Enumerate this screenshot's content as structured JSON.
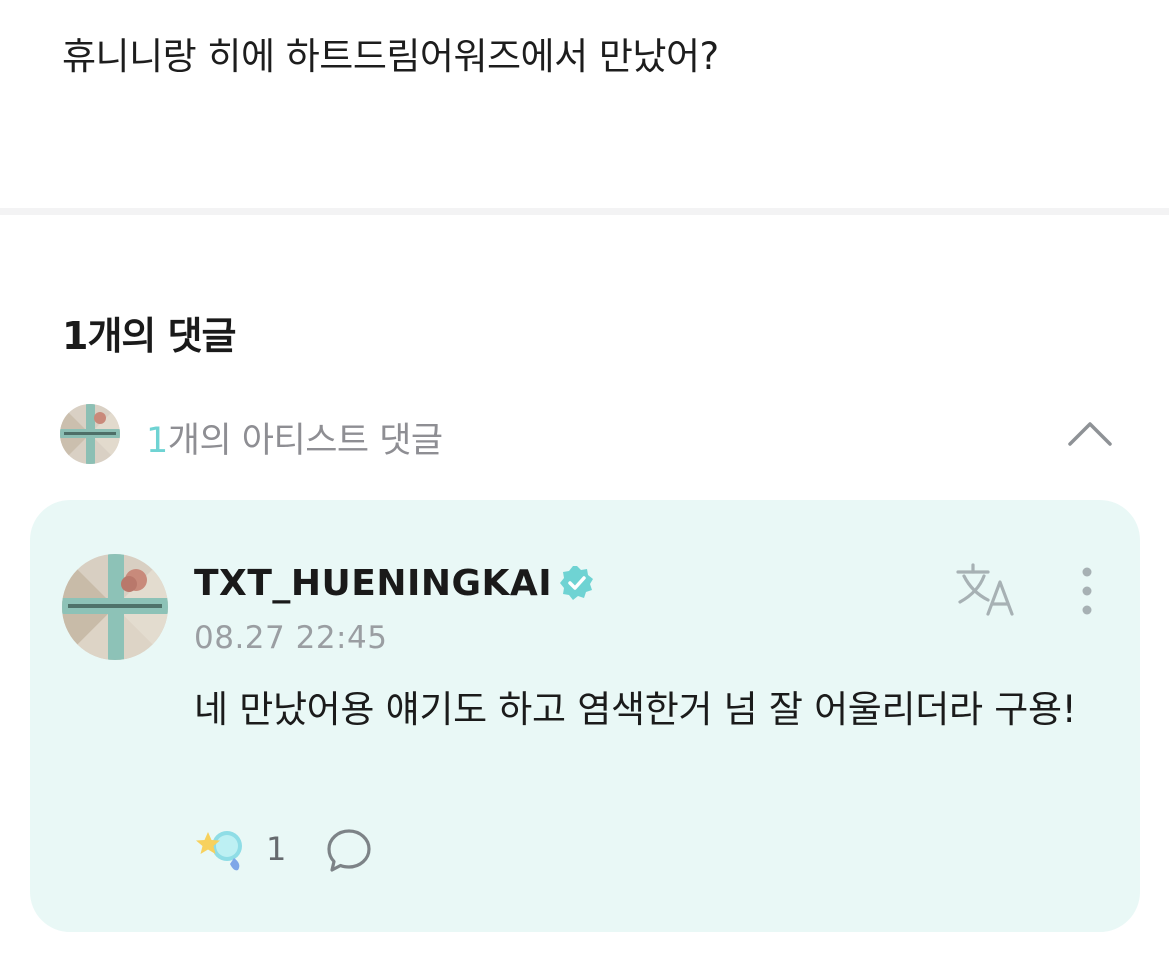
{
  "post": {
    "body": "휴니니랑 히에 하트드림어워즈에서 만났어?"
  },
  "comments": {
    "count_label": "1개의 댓글",
    "artist_summary": {
      "count": "1",
      "label": "개의 아티스트 댓글",
      "avatar_icon": "txt-logo-avatar",
      "toggle_icon": "chevron-up-icon"
    },
    "items": [
      {
        "author": "TXT_HUENINGKAI",
        "verified_icon": "verified-badge-icon",
        "timestamp": "08.27 22:45",
        "text": "네 만났어용 얘기도 하고 염색한거 넘 잘 어울리더라 구용!",
        "reaction_icon": "star-reaction-icon",
        "reaction_count": "1",
        "reply_icon": "speech-bubble-icon",
        "translate_icon": "translate-icon",
        "more_icon": "more-vertical-icon"
      }
    ]
  },
  "colors": {
    "accent": "#6fd3d3",
    "card_background": "#e9f8f6",
    "muted_text": "#8e8e93",
    "icon_gray": "#a9b0b3"
  }
}
